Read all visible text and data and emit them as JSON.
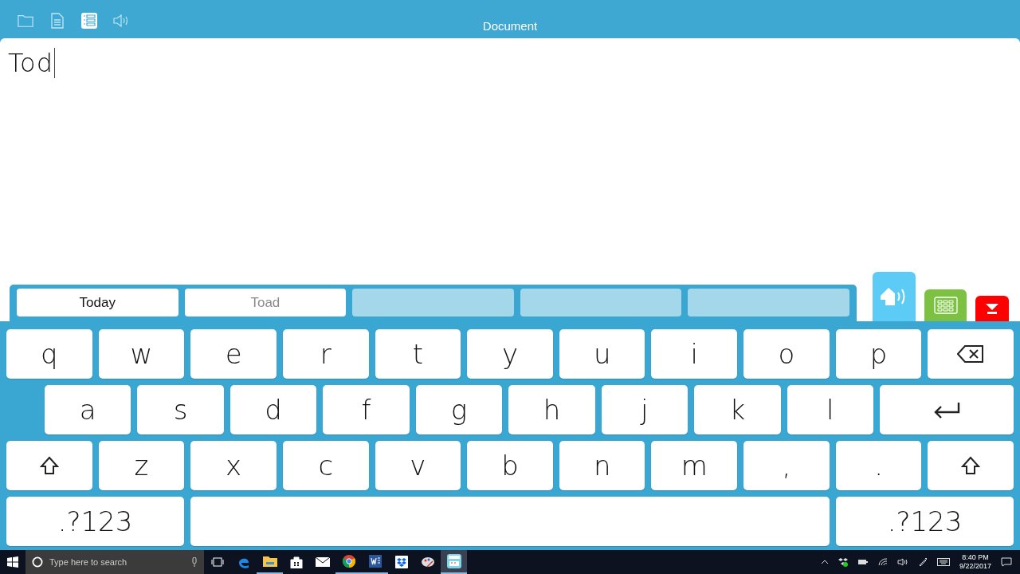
{
  "toolbar": {
    "title": "Document",
    "buttons": [
      {
        "kind": "folder",
        "selected": false
      },
      {
        "kind": "document",
        "selected": false
      },
      {
        "kind": "list",
        "selected": true
      },
      {
        "kind": "speaker",
        "selected": false
      }
    ]
  },
  "document": {
    "text": "Tod"
  },
  "predictions": [
    {
      "kind": "word",
      "text": "Today",
      "highlighted": true
    },
    {
      "kind": "word",
      "text": "Toad",
      "highlighted": false
    },
    {
      "kind": "empty"
    },
    {
      "kind": "empty"
    },
    {
      "kind": "empty"
    }
  ],
  "side_buttons": [
    {
      "kind": "speak"
    },
    {
      "kind": "grid"
    },
    {
      "kind": "hide"
    }
  ],
  "keyboard": {
    "rows": [
      [
        {
          "kind": "char",
          "text": "q"
        },
        {
          "kind": "char",
          "text": "w"
        },
        {
          "kind": "char",
          "text": "e"
        },
        {
          "kind": "char",
          "text": "r"
        },
        {
          "kind": "char",
          "text": "t"
        },
        {
          "kind": "char",
          "text": "y"
        },
        {
          "kind": "char",
          "text": "u"
        },
        {
          "kind": "char",
          "text": "i"
        },
        {
          "kind": "char",
          "text": "o"
        },
        {
          "kind": "char",
          "text": "p"
        },
        {
          "kind": "backspace"
        }
      ],
      [
        {
          "kind": "char",
          "text": "a"
        },
        {
          "kind": "char",
          "text": "s"
        },
        {
          "kind": "char",
          "text": "d"
        },
        {
          "kind": "char",
          "text": "f"
        },
        {
          "kind": "char",
          "text": "g"
        },
        {
          "kind": "char",
          "text": "h"
        },
        {
          "kind": "char",
          "text": "j"
        },
        {
          "kind": "char",
          "text": "k"
        },
        {
          "kind": "char",
          "text": "l"
        },
        {
          "kind": "enter"
        }
      ],
      [
        {
          "kind": "shift"
        },
        {
          "kind": "char",
          "text": "z"
        },
        {
          "kind": "char",
          "text": "x"
        },
        {
          "kind": "char",
          "text": "c"
        },
        {
          "kind": "char",
          "text": "v"
        },
        {
          "kind": "char",
          "text": "b"
        },
        {
          "kind": "char",
          "text": "n"
        },
        {
          "kind": "char",
          "text": "m"
        },
        {
          "kind": "char",
          "text": ","
        },
        {
          "kind": "char",
          "text": "."
        },
        {
          "kind": "shift"
        }
      ],
      [
        {
          "kind": "symbols",
          "text": ".?123"
        },
        {
          "kind": "space"
        },
        {
          "kind": "symbols",
          "text": ".?123"
        }
      ]
    ]
  },
  "taskbar": {
    "search": {
      "placeholder": "Type here to search"
    },
    "apps": [
      {
        "kind": "taskview",
        "running": false,
        "active": false
      },
      {
        "kind": "edge",
        "running": false,
        "active": false
      },
      {
        "kind": "explorer",
        "running": true,
        "active": false
      },
      {
        "kind": "store",
        "running": false,
        "active": false
      },
      {
        "kind": "mail",
        "running": false,
        "active": false
      },
      {
        "kind": "chrome",
        "running": true,
        "active": false
      },
      {
        "kind": "word",
        "running": true,
        "active": false
      },
      {
        "kind": "dropbox",
        "running": false,
        "active": false
      },
      {
        "kind": "paint",
        "running": false,
        "active": false
      },
      {
        "kind": "keyboard-app",
        "running": true,
        "active": true
      }
    ],
    "time": "8:40 PM",
    "date": "9/22/2017"
  }
}
